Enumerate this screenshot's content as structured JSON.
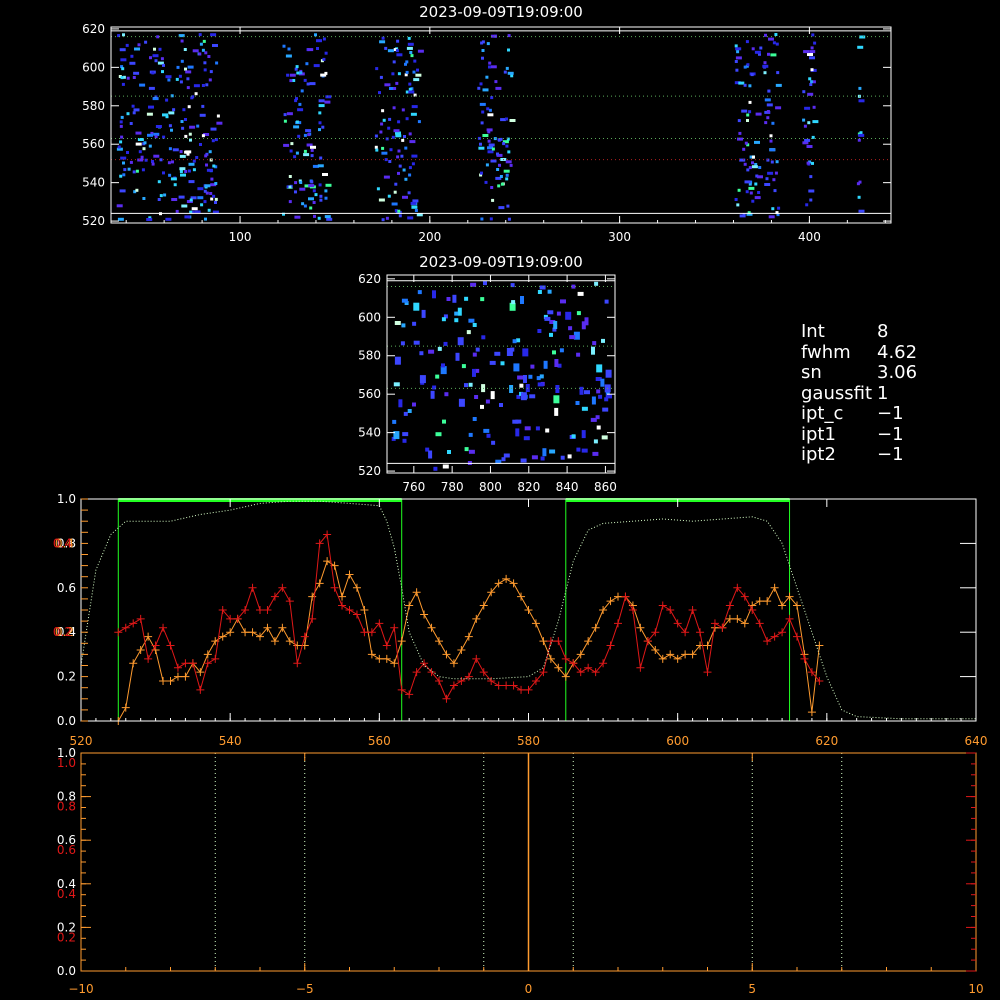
{
  "colors": {
    "background": "#000000",
    "axis": "#ffffff",
    "orange": "#ff9b2f",
    "red": "#e01818",
    "green": "#22ff22",
    "pale": "#d8ffc8",
    "dotted_green": "#5aaa5a",
    "dotted_red": "#b02020"
  },
  "info_panel": [
    {
      "key": "Int",
      "value": "8"
    },
    {
      "key": "fwhm",
      "value": "4.62"
    },
    {
      "key": "sn",
      "value": "3.06"
    },
    {
      "key": "gaussfit",
      "value": "1"
    },
    {
      "key": "ipt_c",
      "value": "−1"
    },
    {
      "key": "ipt1",
      "value": "−1"
    },
    {
      "key": "ipt2",
      "value": "−1"
    }
  ],
  "chart_data": [
    {
      "type": "heatmap",
      "title": "2023-09-09T19:09:00",
      "xlim": [
        32,
        443
      ],
      "ylim": [
        519,
        621
      ],
      "x_ticks": [
        "100",
        "200",
        "300",
        "400"
      ],
      "y_ticks": [
        "520",
        "540",
        "560",
        "580",
        "600",
        "620"
      ],
      "solid_lines_y": [
        524,
        619
      ],
      "dotted_green_lines_y": [
        616,
        585,
        563
      ],
      "dotted_red_lines_y": [
        552
      ],
      "data_bands_x": [
        [
          35,
          90
        ],
        [
          122,
          147
        ],
        [
          171,
          196
        ],
        [
          225,
          244
        ],
        [
          360,
          385
        ],
        [
          396,
          404
        ],
        [
          425,
          428
        ]
      ]
    },
    {
      "type": "heatmap",
      "title": "2023-09-09T19:09:00",
      "xlim": [
        746,
        865
      ],
      "ylim": [
        519,
        622
      ],
      "x_ticks": [
        "760",
        "780",
        "800",
        "820",
        "840",
        "860"
      ],
      "y_ticks": [
        "520",
        "540",
        "560",
        "580",
        "600",
        "620"
      ],
      "solid_lines_y": [
        524,
        619
      ],
      "dotted_green_lines_y": [
        616,
        585,
        563
      ]
    },
    {
      "type": "line",
      "xlim": [
        520,
        640
      ],
      "ylim": [
        0.0,
        0.5
      ],
      "x_ticks": [
        "520",
        "540",
        "560",
        "580",
        "600",
        "620",
        "640"
      ],
      "y_ticks_white": [
        "0.0",
        "0.2",
        "0.4",
        "0.6",
        "0.8",
        "1.0"
      ],
      "y_ticks_orange": [
        "0.2",
        "0.4"
      ],
      "y_ticks_red": [
        "0.2",
        "0.4"
      ],
      "green_vertical_lines_x": [
        525,
        563,
        585,
        615
      ],
      "green_bars": [
        [
          525,
          563
        ],
        [
          585,
          615
        ]
      ],
      "series": [
        {
          "color": "orange",
          "x": [
            525,
            526,
            527,
            528,
            529,
            530,
            531,
            532,
            533,
            534,
            535,
            536,
            537,
            538,
            539,
            540,
            541,
            542,
            543,
            544,
            545,
            546,
            547,
            548,
            549,
            550,
            551,
            552,
            553,
            554,
            555,
            556,
            557,
            558,
            559,
            560,
            561,
            562,
            563,
            564,
            565,
            566,
            567,
            568,
            569,
            570,
            571,
            572,
            573,
            574,
            575,
            576,
            577,
            578,
            579,
            580,
            581,
            582,
            583,
            584,
            585,
            586,
            587,
            588,
            589,
            590,
            591,
            592,
            593,
            594,
            595,
            596,
            597,
            598,
            599,
            600,
            601,
            602,
            603,
            604,
            605,
            606,
            607,
            608,
            609,
            610,
            611,
            612,
            613,
            614,
            615,
            616,
            617,
            618,
            619
          ],
          "y": [
            0.0,
            0.03,
            0.13,
            0.16,
            0.19,
            0.16,
            0.09,
            0.09,
            0.1,
            0.1,
            0.13,
            0.11,
            0.15,
            0.18,
            0.19,
            0.2,
            0.23,
            0.2,
            0.2,
            0.19,
            0.21,
            0.18,
            0.21,
            0.18,
            0.17,
            0.17,
            0.28,
            0.31,
            0.36,
            0.35,
            0.28,
            0.33,
            0.3,
            0.25,
            0.15,
            0.14,
            0.14,
            0.13,
            0.18,
            0.26,
            0.29,
            0.24,
            0.21,
            0.18,
            0.15,
            0.13,
            0.16,
            0.19,
            0.23,
            0.26,
            0.29,
            0.31,
            0.32,
            0.31,
            0.28,
            0.25,
            0.22,
            0.18,
            0.14,
            0.12,
            0.1,
            0.13,
            0.15,
            0.18,
            0.21,
            0.25,
            0.27,
            0.28,
            0.28,
            0.26,
            0.21,
            0.18,
            0.16,
            0.14,
            0.15,
            0.14,
            0.15,
            0.15,
            0.17,
            0.17,
            0.21,
            0.21,
            0.23,
            0.23,
            0.22,
            0.26,
            0.27,
            0.27,
            0.3,
            0.26,
            0.28,
            0.26,
            0.15,
            0.02,
            0.17
          ]
        },
        {
          "color": "red",
          "x": [
            525,
            526,
            527,
            528,
            529,
            530,
            531,
            532,
            533,
            534,
            535,
            536,
            537,
            538,
            539,
            540,
            541,
            542,
            543,
            544,
            545,
            546,
            547,
            548,
            549,
            550,
            551,
            552,
            553,
            554,
            555,
            556,
            557,
            558,
            559,
            560,
            561,
            562,
            563,
            564,
            565,
            566,
            567,
            568,
            569,
            570,
            571,
            572,
            573,
            574,
            575,
            576,
            577,
            578,
            579,
            580,
            581,
            582,
            583,
            584,
            585,
            586,
            587,
            588,
            589,
            590,
            591,
            592,
            593,
            594,
            595,
            596,
            597,
            598,
            599,
            600,
            601,
            602,
            603,
            604,
            605,
            606,
            607,
            608,
            609,
            610,
            611,
            612,
            613,
            614,
            615,
            616,
            617,
            618,
            619
          ],
          "y": [
            0.2,
            0.21,
            0.22,
            0.23,
            0.14,
            0.17,
            0.21,
            0.17,
            0.12,
            0.13,
            0.13,
            0.07,
            0.13,
            0.14,
            0.25,
            0.23,
            0.23,
            0.25,
            0.3,
            0.25,
            0.25,
            0.28,
            0.3,
            0.27,
            0.13,
            0.19,
            0.23,
            0.4,
            0.42,
            0.3,
            0.26,
            0.25,
            0.24,
            0.2,
            0.2,
            0.22,
            0.17,
            0.21,
            0.07,
            0.06,
            0.11,
            0.13,
            0.11,
            0.09,
            0.05,
            0.08,
            0.09,
            0.1,
            0.14,
            0.11,
            0.09,
            0.08,
            0.08,
            0.08,
            0.07,
            0.07,
            0.09,
            0.11,
            0.18,
            0.18,
            0.14,
            0.13,
            0.11,
            0.12,
            0.11,
            0.13,
            0.17,
            0.22,
            0.28,
            0.25,
            0.12,
            0.18,
            0.2,
            0.26,
            0.25,
            0.22,
            0.2,
            0.25,
            0.2,
            0.11,
            0.22,
            0.21,
            0.26,
            0.3,
            0.28,
            0.25,
            0.22,
            0.18,
            0.19,
            0.2,
            0.23,
            0.19,
            0.14,
            0.11,
            0.09
          ]
        },
        {
          "color": "pale-dotted",
          "x": [
            520,
            522,
            524,
            526,
            528,
            532,
            536,
            540,
            544,
            548,
            552,
            556,
            560,
            561,
            562,
            563,
            564,
            566,
            568,
            570,
            575,
            580,
            582,
            584,
            586,
            588,
            590,
            594,
            598,
            602,
            606,
            610,
            612,
            614,
            616,
            618,
            620,
            622,
            624,
            630,
            635,
            640
          ],
          "y": [
            0.25,
            0.68,
            0.84,
            0.9,
            0.9,
            0.9,
            0.93,
            0.95,
            0.98,
            0.99,
            0.99,
            0.98,
            0.97,
            0.9,
            0.78,
            0.6,
            0.4,
            0.25,
            0.2,
            0.19,
            0.19,
            0.2,
            0.24,
            0.45,
            0.72,
            0.86,
            0.89,
            0.9,
            0.91,
            0.9,
            0.91,
            0.92,
            0.9,
            0.8,
            0.6,
            0.4,
            0.2,
            0.05,
            0.02,
            0.01,
            0.01,
            0.01
          ]
        }
      ]
    },
    {
      "type": "line",
      "xlim": [
        -10,
        10
      ],
      "ylim": [
        0.0,
        1.0
      ],
      "x_ticks": [
        "−10",
        "−5",
        "0",
        "5",
        "10"
      ],
      "y_ticks_white": [
        "0.0",
        "0.2",
        "0.4",
        "0.6",
        "0.8",
        "1.0"
      ],
      "y_ticks_red": [
        "0.2",
        "0.4",
        "0.6",
        "0.8",
        "1.0"
      ],
      "dotted_lines_x": [
        -7,
        -5,
        -1,
        1,
        5,
        7
      ],
      "orange_line_x": 0
    }
  ]
}
